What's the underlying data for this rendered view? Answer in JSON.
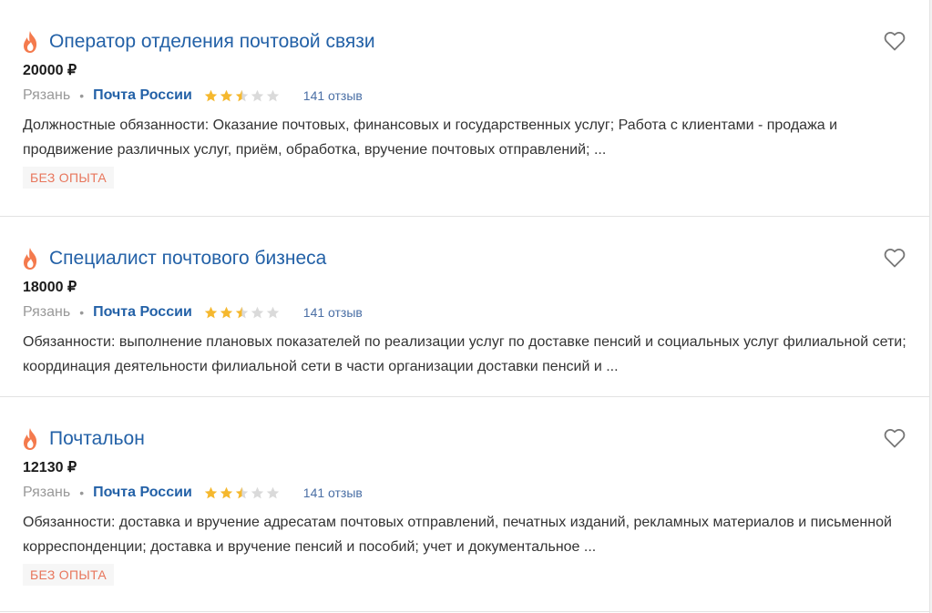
{
  "colors": {
    "title": "#2361a7",
    "fire": "#f47a4d",
    "star_on": "#f5b82e",
    "star_off": "#dadada",
    "badge_text": "#e8765c"
  },
  "vacancies": [
    {
      "title": "Оператор отделения почтовой связи",
      "salary": "20000 ₽",
      "city": "Рязань",
      "separator": "•",
      "company": "Почта России",
      "rating": 2.5,
      "reviews": "141 отзыв",
      "description": "Должностные обязанности: Оказание почтовых, финансовых и государственных услуг; Работа с клиентами - продажа и продвижение различных услуг, приём, обработка, вручение почтовых отправлений; ...",
      "badge": "БЕЗ ОПЫТА",
      "icons": {
        "hot": "fire-icon",
        "favorite": "heart-icon"
      }
    },
    {
      "title": "Специалист почтового бизнеса",
      "salary": "18000 ₽",
      "city": "Рязань",
      "separator": "•",
      "company": "Почта России",
      "rating": 2.5,
      "reviews": "141 отзыв",
      "description": "Обязанности: выполнение плановых показателей по реализации услуг по доставке пенсий и социальных услуг филиальной сети; координация деятельности филиальной сети в части организации доставки пенсий и ...",
      "icons": {
        "hot": "fire-icon",
        "favorite": "heart-icon"
      }
    },
    {
      "title": "Почтальон",
      "salary": "12130 ₽",
      "city": "Рязань",
      "separator": "•",
      "company": "Почта России",
      "rating": 2.5,
      "reviews": "141 отзыв",
      "description": "Обязанности: доставка и вручение адресатам почтовых отправлений, печатных изданий, рекламных материалов и письменной корреспонденции; доставка и вручение пенсий и пособий; учет и документальное ...",
      "badge": "БЕЗ ОПЫТА",
      "icons": {
        "hot": "fire-icon",
        "favorite": "heart-icon"
      }
    }
  ]
}
